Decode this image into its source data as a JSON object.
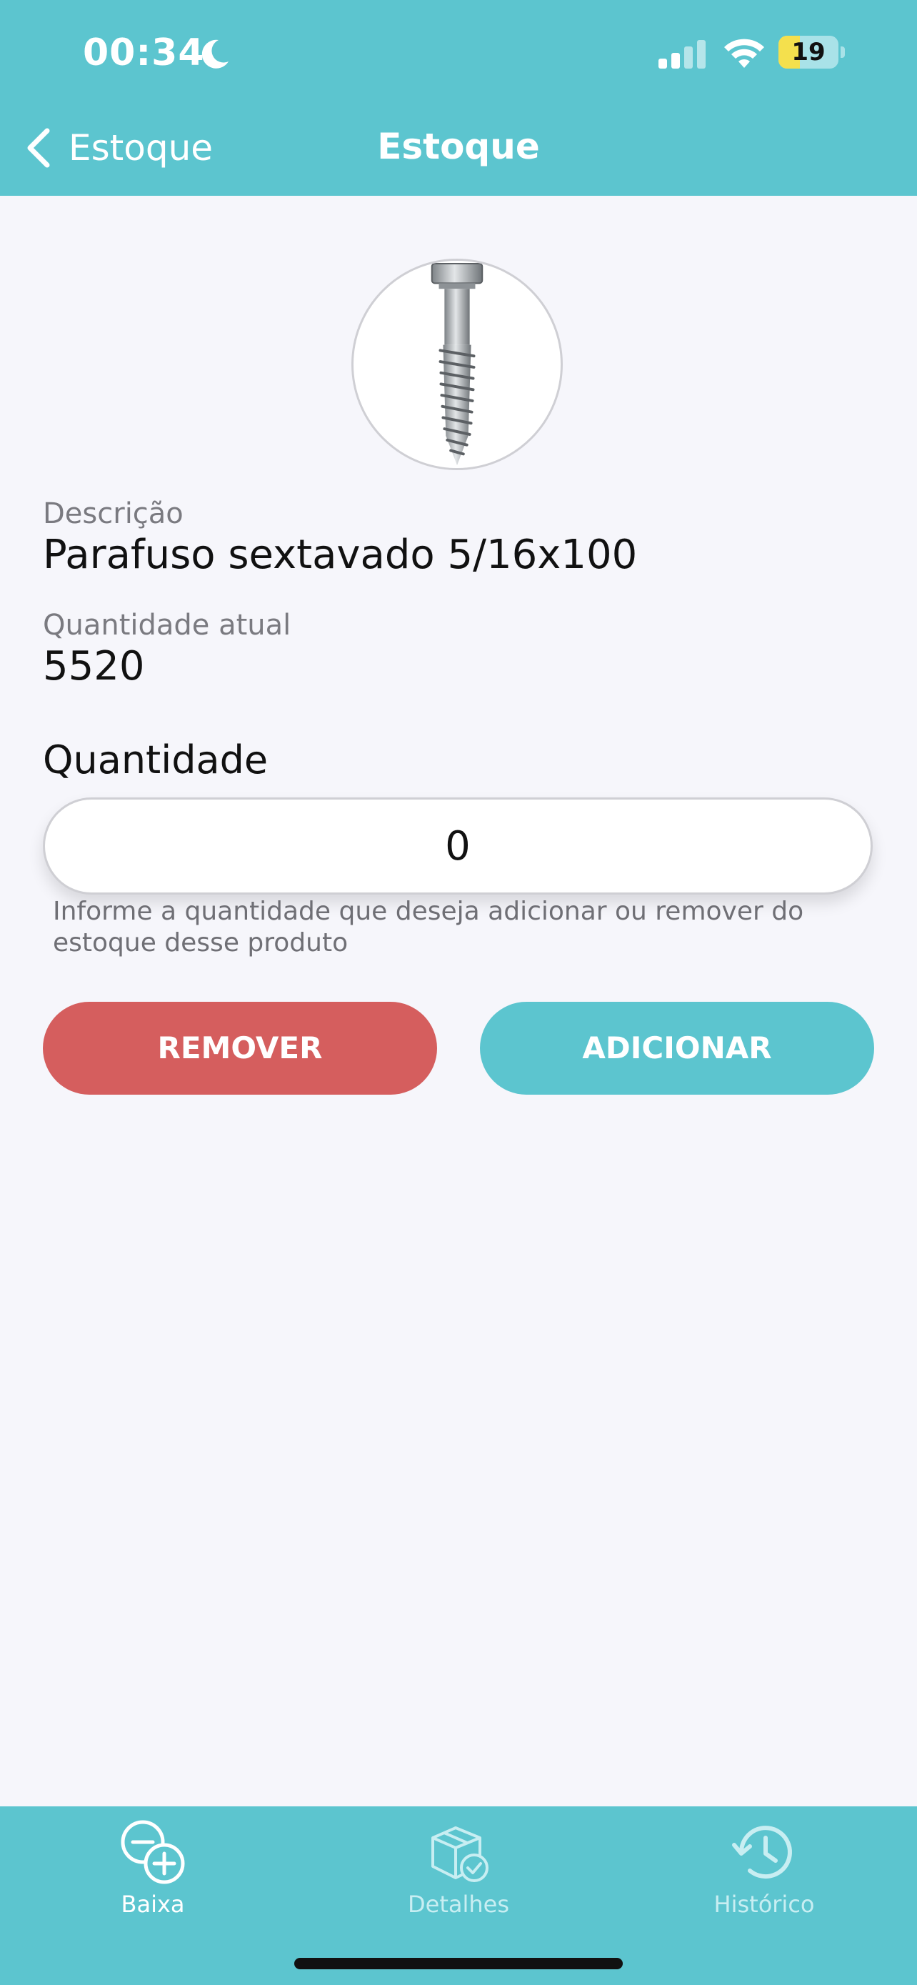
{
  "status_bar": {
    "time": "00:34",
    "battery": "19",
    "battery_level": 0.19
  },
  "nav": {
    "back_label": "Estoque",
    "title": "Estoque"
  },
  "product": {
    "image_icon": "screw-image",
    "description_label": "Descrição",
    "description_value": "Parafuso sextavado 5/16x100",
    "current_qty_label": "Quantidade atual",
    "current_qty_value": "5520"
  },
  "quantity": {
    "title": "Quantidade",
    "value": "0",
    "helper": "Informe a quantidade que deseja adicionar ou remover do estoque desse produto"
  },
  "actions": {
    "remove_label": "REMOVER",
    "add_label": "ADICIONAR"
  },
  "tabs": [
    {
      "label": "Baixa",
      "icon": "minus-plus-icon",
      "active": true
    },
    {
      "label": "Detalhes",
      "icon": "box-check-icon",
      "active": false
    },
    {
      "label": "Histórico",
      "icon": "history-icon",
      "active": false
    }
  ],
  "colors": {
    "primary": "#5cc5cf",
    "danger": "#d55e5e",
    "background": "#f6f6fb"
  }
}
